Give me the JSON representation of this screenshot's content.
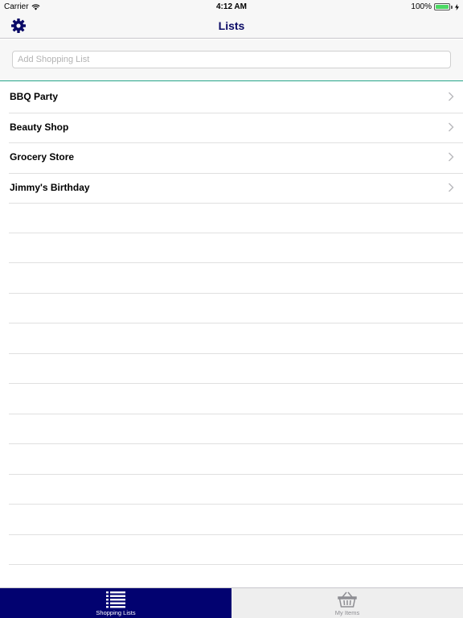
{
  "status_bar": {
    "carrier": "Carrier",
    "time": "4:12 AM",
    "battery": "100%",
    "wifi_icon": "wifi-icon",
    "battery_icon": "battery-icon",
    "battery_color": "#4cd964"
  },
  "nav": {
    "title": "Lists",
    "settings_icon": "gear-icon",
    "accent": "#0a0a66"
  },
  "add_list": {
    "placeholder": "Add Shopping List",
    "value": ""
  },
  "lists": [
    {
      "label": "BBQ Party"
    },
    {
      "label": "Beauty Shop"
    },
    {
      "label": "Grocery Store"
    },
    {
      "label": "Jimmy's Birthday"
    }
  ],
  "tabs": [
    {
      "label": "Shopping Lists",
      "icon": "list-icon",
      "active": true
    },
    {
      "label": "My Items",
      "icon": "basket-icon",
      "active": false
    }
  ],
  "colors": {
    "tab_active_bg": "#020270",
    "separator_accent": "#27a58a"
  }
}
